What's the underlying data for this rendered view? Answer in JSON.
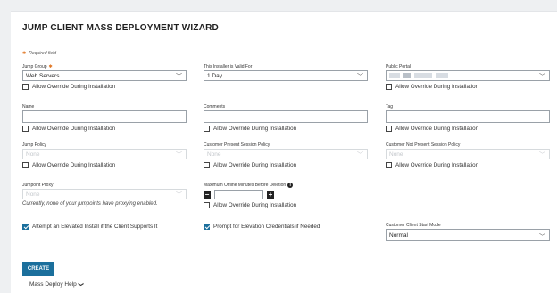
{
  "title": "JUMP CLIENT MASS DEPLOYMENT WIZARD",
  "required_note": "Required field",
  "override": "Allow Override During Installation",
  "jump_group": {
    "label": "Jump Group",
    "value": "Web Servers"
  },
  "valid_for": {
    "label": "This Installer is Valid For",
    "value": "1 Day"
  },
  "public_portal": {
    "label": "Public Portal"
  },
  "name": {
    "label": "Name",
    "value": ""
  },
  "comments": {
    "label": "Comments",
    "value": ""
  },
  "tag": {
    "label": "Tag",
    "value": ""
  },
  "jump_policy": {
    "label": "Jump Policy",
    "value": "None"
  },
  "present_policy": {
    "label": "Customer Present Session Policy",
    "value": "None"
  },
  "not_present_policy": {
    "label": "Customer Not Present Session Policy",
    "value": "None"
  },
  "jumpoint_proxy": {
    "label": "Jumpoint Proxy",
    "value": "None",
    "note": "Currently, none of your jumpoints have proxying enabled."
  },
  "max_offline": {
    "label": "Maximum Offline Minutes Before Deletion",
    "value": ""
  },
  "elevated_install": "Attempt an Elevated Install if the Client Supports It",
  "prompt_elevation": "Prompt for Elevation Credentials if Needed",
  "start_mode": {
    "label": "Customer Client Start Mode",
    "value": "Normal"
  },
  "create_label": "CREATE",
  "help_label": "Mass Deploy Help"
}
